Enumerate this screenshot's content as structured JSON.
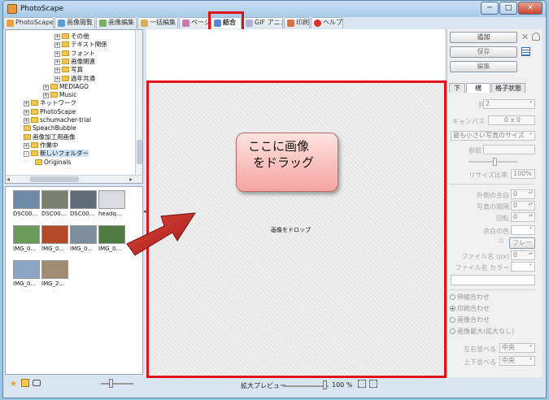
{
  "window": {
    "title": "PhotoScape",
    "minimize": "─",
    "maximize": "□",
    "close": "✕"
  },
  "tabs": [
    {
      "label": "PhotoScape",
      "icon": "photoscape-icon"
    },
    {
      "label": "画像閲覧",
      "icon": "viewer-icon"
    },
    {
      "label": "画像編集",
      "icon": "editor-icon"
    },
    {
      "label": "一括編集",
      "icon": "batch-icon"
    },
    {
      "label": "ページ",
      "icon": "page-icon"
    },
    {
      "label": "結合",
      "icon": "combine-icon",
      "active": true
    },
    {
      "label": "GIF アニメ",
      "icon": "gif-icon"
    },
    {
      "label": "印刷",
      "icon": "print-icon"
    },
    {
      "label": "ヘルプ",
      "icon": "help-icon"
    }
  ],
  "tree": [
    {
      "label": "その他",
      "level": 3,
      "expander": "+"
    },
    {
      "label": "テキスト関係",
      "level": 3,
      "expander": "+"
    },
    {
      "label": "フォント",
      "level": 3,
      "expander": "+"
    },
    {
      "label": "画像関連",
      "level": 3,
      "expander": "+"
    },
    {
      "label": "写真",
      "level": 3,
      "expander": "+"
    },
    {
      "label": "過年共通",
      "level": 3,
      "expander": "+"
    },
    {
      "label": "MEDIAGO",
      "level": 2,
      "expander": "+"
    },
    {
      "label": "Music",
      "level": 2,
      "expander": "+"
    },
    {
      "label": "ネットワーク",
      "level": 0,
      "expander": "+"
    },
    {
      "label": "PhotoScape",
      "level": 0,
      "expander": "+"
    },
    {
      "label": "schumacher-trial",
      "level": 0,
      "expander": "+"
    },
    {
      "label": "SpeachBubble",
      "level": 0,
      "expander": ""
    },
    {
      "label": "画像加工用画像",
      "level": 0,
      "expander": ""
    },
    {
      "label": "作業中",
      "level": 0,
      "expander": "+"
    },
    {
      "label": "新しいフォルダー",
      "level": 0,
      "expander": "-",
      "selected": true
    },
    {
      "label": "Originals",
      "level": 1,
      "expander": ""
    }
  ],
  "scroll_arrows": {
    "left": "◂",
    "right": "▸"
  },
  "thumbnails": [
    {
      "caption": "DSC00...",
      "color": "#6d8ba8"
    },
    {
      "caption": "DSC00...",
      "color": "#7a7f70"
    },
    {
      "caption": "DSC00...",
      "color": "#5e6c78"
    },
    {
      "caption": "headq...",
      "color": "#d9dbe0"
    },
    {
      "caption": "IMG_0...",
      "color": "#6a9a5a"
    },
    {
      "caption": "IMG_0...",
      "color": "#b24a2a"
    },
    {
      "caption": "IMG_0...",
      "color": "#7c8e9c"
    },
    {
      "caption": "IMG_0...",
      "color": "#4e7a42"
    },
    {
      "caption": "IMG_0...",
      "color": "#8aa6c4"
    },
    {
      "caption": "IMG_2...",
      "color": "#a08c72"
    }
  ],
  "canvas": {
    "drop_text": "画像をドロップ"
  },
  "callout": {
    "line1": "ここに画像",
    "line2": "をドラッグ"
  },
  "bottom": {
    "zoom_label": "拡大プレビュー",
    "zoom_value": "100 %"
  },
  "right": {
    "add_button": "追加",
    "save_button": "保存",
    "edit_button": "編集",
    "tabs": [
      "下",
      "横",
      "格子状態"
    ],
    "count_label": "列",
    "count_value": "2",
    "canvas_label": "キャンバス",
    "canvas_value": "0 x 0",
    "size_select": "最も小さい写真のサイズ",
    "ref_label": "参照",
    "resize_label": "リサイズ比率",
    "resize_value": "100%",
    "outer_margin_label": "外側の余白",
    "outer_margin_value": "0",
    "photo_gap_label": "写真の間隔",
    "photo_gap_value": "0",
    "round_label": "回転",
    "round_value": "0",
    "margin_color_label": "余白の色",
    "frame_button": "フレーム",
    "filename_px_label": "ファイル名 (px)",
    "filename_px_value": "0",
    "filename_color_label": "ファイル名 カラー",
    "radios": [
      "伸縮合わせ",
      "印刷合わせ",
      "画像合わせ",
      "画像最大(拡大なし)"
    ],
    "selected_radio": 1,
    "h_align_label": "左右並べる",
    "h_align_value": "中央",
    "v_align_label": "上下並べる",
    "v_align_value": "中央"
  }
}
